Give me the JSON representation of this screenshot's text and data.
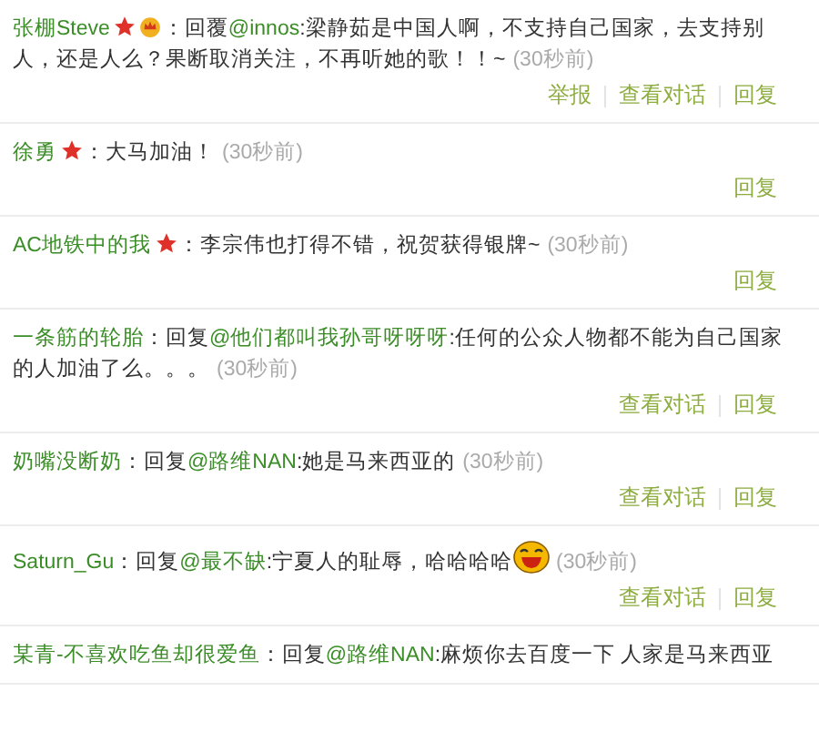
{
  "comments": [
    {
      "user": "张棚Steve",
      "badges": [
        {
          "kind": "star"
        },
        {
          "kind": "crown"
        }
      ],
      "prefix": "：回覆",
      "mention": "@innos",
      "text": ":梁静茹是中国人啊，不支持自己国家，去支持别人，还是人么？果断取消关注，不再听她的歌！！~",
      "time": "(30秒前)",
      "actions": [
        "举报",
        "查看对话",
        "回复"
      ]
    },
    {
      "user": "徐勇",
      "badges": [
        {
          "kind": "star"
        }
      ],
      "prefix": "：",
      "text": "大马加油！",
      "time": "(30秒前)",
      "actions": [
        "回复"
      ]
    },
    {
      "user": "AC地铁中的我",
      "badges": [
        {
          "kind": "star"
        }
      ],
      "prefix": "：",
      "text": "李宗伟也打得不错，祝贺获得银牌~",
      "time": "(30秒前)",
      "actions": [
        "回复"
      ]
    },
    {
      "user": "一条筋的轮胎",
      "prefix": "：回复",
      "mention": "@他们都叫我孙哥呀呀呀",
      "text": ":任何的公众人物都不能为自己国家的人加油了么。。。",
      "time": "(30秒前)",
      "actions": [
        "查看对话",
        "回复"
      ]
    },
    {
      "user": "奶嘴没断奶",
      "prefix": "：回复",
      "mention": "@路维NAN",
      "text": ":她是马来西亚的",
      "time": "(30秒前)",
      "actions": [
        "查看对话",
        "回复"
      ]
    },
    {
      "user": "Saturn_Gu",
      "prefix": "：回复",
      "mention": "@最不缺",
      "text": ":宁夏人的耻辱，哈哈哈哈",
      "emoticon": {
        "kind": "laugh"
      },
      "time": "(30秒前)",
      "actions": [
        "查看对话",
        "回复"
      ]
    },
    {
      "user": "某青-不喜欢吃鱼却很爱鱼",
      "prefix": "：回复",
      "mention": "@路维NAN",
      "text": ":麻烦你去百度一下 人家是马来西亚"
    }
  ]
}
